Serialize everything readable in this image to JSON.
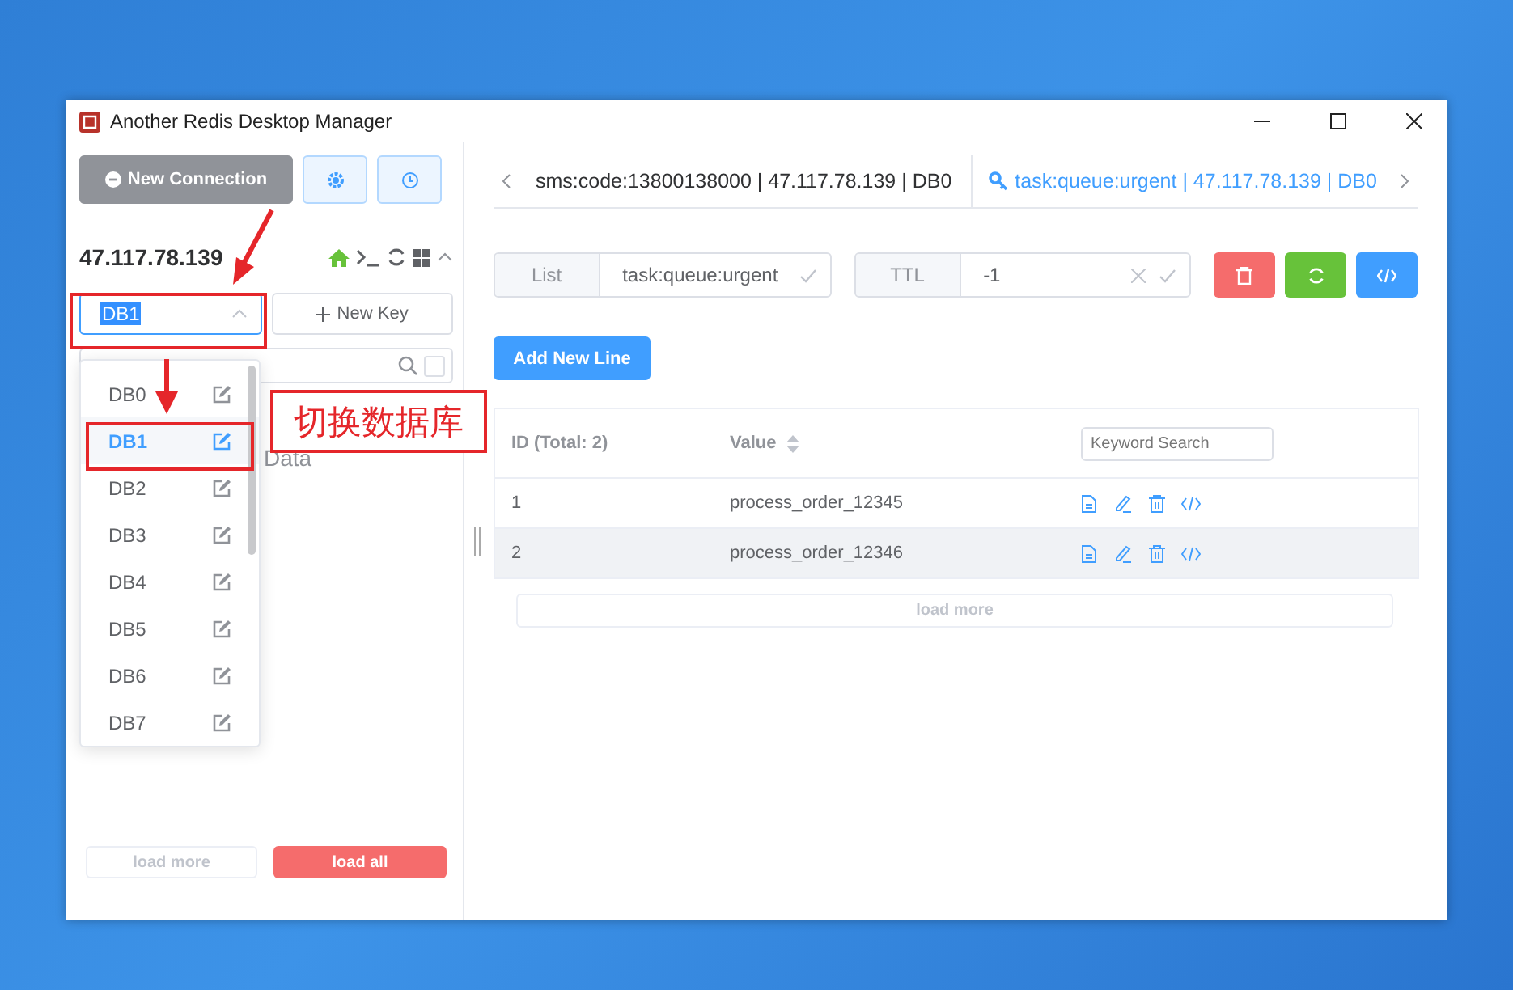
{
  "window": {
    "title": "Another Redis Desktop Manager"
  },
  "sidebar": {
    "new_connection_button": "New Connection",
    "connection": {
      "host": "47.117.78.139"
    },
    "db_select": {
      "value": "DB1"
    },
    "new_key_button": "New Key",
    "select_all_checkbox": {
      "checked": false
    },
    "key_list": {
      "empty_text": "Data"
    },
    "load_more_button": {
      "label": "load more",
      "disabled": true
    },
    "load_all_button": {
      "label": "load all",
      "disabled": false
    }
  },
  "db_dropdown": {
    "items": [
      {
        "label": "DB0",
        "selected": false
      },
      {
        "label": "DB1",
        "selected": true
      },
      {
        "label": "DB2",
        "selected": false
      },
      {
        "label": "DB3",
        "selected": false
      },
      {
        "label": "DB4",
        "selected": false
      },
      {
        "label": "DB5",
        "selected": false
      },
      {
        "label": "DB6",
        "selected": false
      },
      {
        "label": "DB7",
        "selected": false
      }
    ]
  },
  "annotation": {
    "callout": "切换数据库"
  },
  "tabs": [
    {
      "label": "sms:code:13800138000 | 47.117.78.139 | DB0",
      "selected": false
    },
    {
      "label": "task:queue:urgent | 47.117.78.139 | DB0",
      "selected": true
    }
  ],
  "key_header": {
    "type": "List",
    "key_name": "task:queue:urgent",
    "ttl_label": "TTL",
    "ttl_value": "-1"
  },
  "add_button": "Add New Line",
  "table": {
    "columns": [
      "ID (Total: 2)",
      "Value"
    ],
    "search": {
      "placeholder": "Keyword Search"
    },
    "rows": [
      {
        "id": "1",
        "value": "process_order_12345",
        "highlighted": false
      },
      {
        "id": "2",
        "value": "process_order_12346",
        "highlighted": true
      }
    ]
  },
  "load_more_button": {
    "label": "load more",
    "disabled": true
  }
}
